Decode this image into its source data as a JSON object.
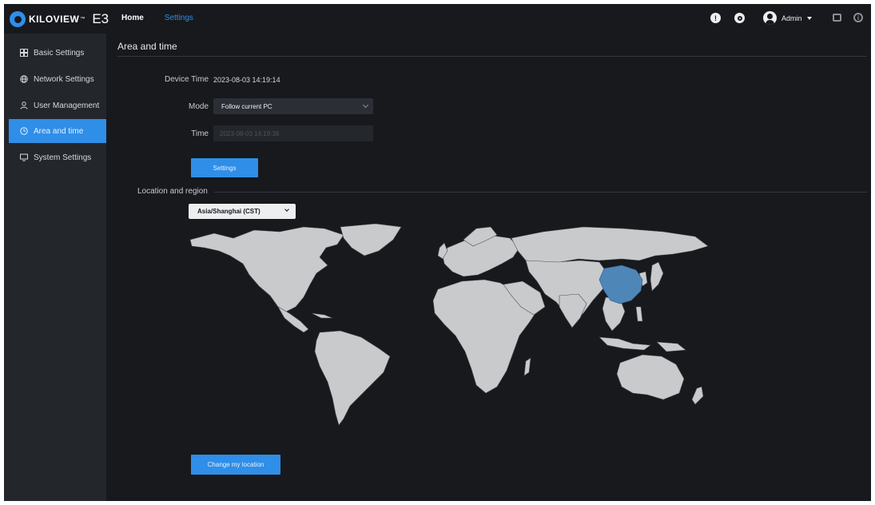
{
  "app": {
    "brand": "KILOVIEW",
    "trademark": "™",
    "model": "E3"
  },
  "nav": {
    "home": "Home",
    "settings": "Settings"
  },
  "header": {
    "user": "Admin"
  },
  "sidebar": {
    "items": [
      {
        "label": "Basic Settings",
        "icon": "grid-icon"
      },
      {
        "label": "Network Settings",
        "icon": "globe-icon"
      },
      {
        "label": "User Management",
        "icon": "user-icon"
      },
      {
        "label": "Area and time",
        "icon": "clock-icon",
        "active": true
      },
      {
        "label": "System Settings",
        "icon": "monitor-icon"
      }
    ]
  },
  "page": {
    "title": "Area and time",
    "device_time_label": "Device Time",
    "device_time_value": "2023-08-03 14:19:14",
    "mode_label": "Mode",
    "mode_value": "Follow current PC",
    "time_label": "Time",
    "time_value": "2023-08-03 14:19:38",
    "settings_button": "Settings",
    "location_label": "Location and region",
    "timezone_value": "Asia/Shanghai (CST)",
    "change_location_button": "Change my location"
  },
  "colors": {
    "accent": "#2f8ee8",
    "background": "#17191d",
    "sidebar": "#23262b",
    "land": "#c9cacc",
    "selected_region": "#4f86b8"
  }
}
